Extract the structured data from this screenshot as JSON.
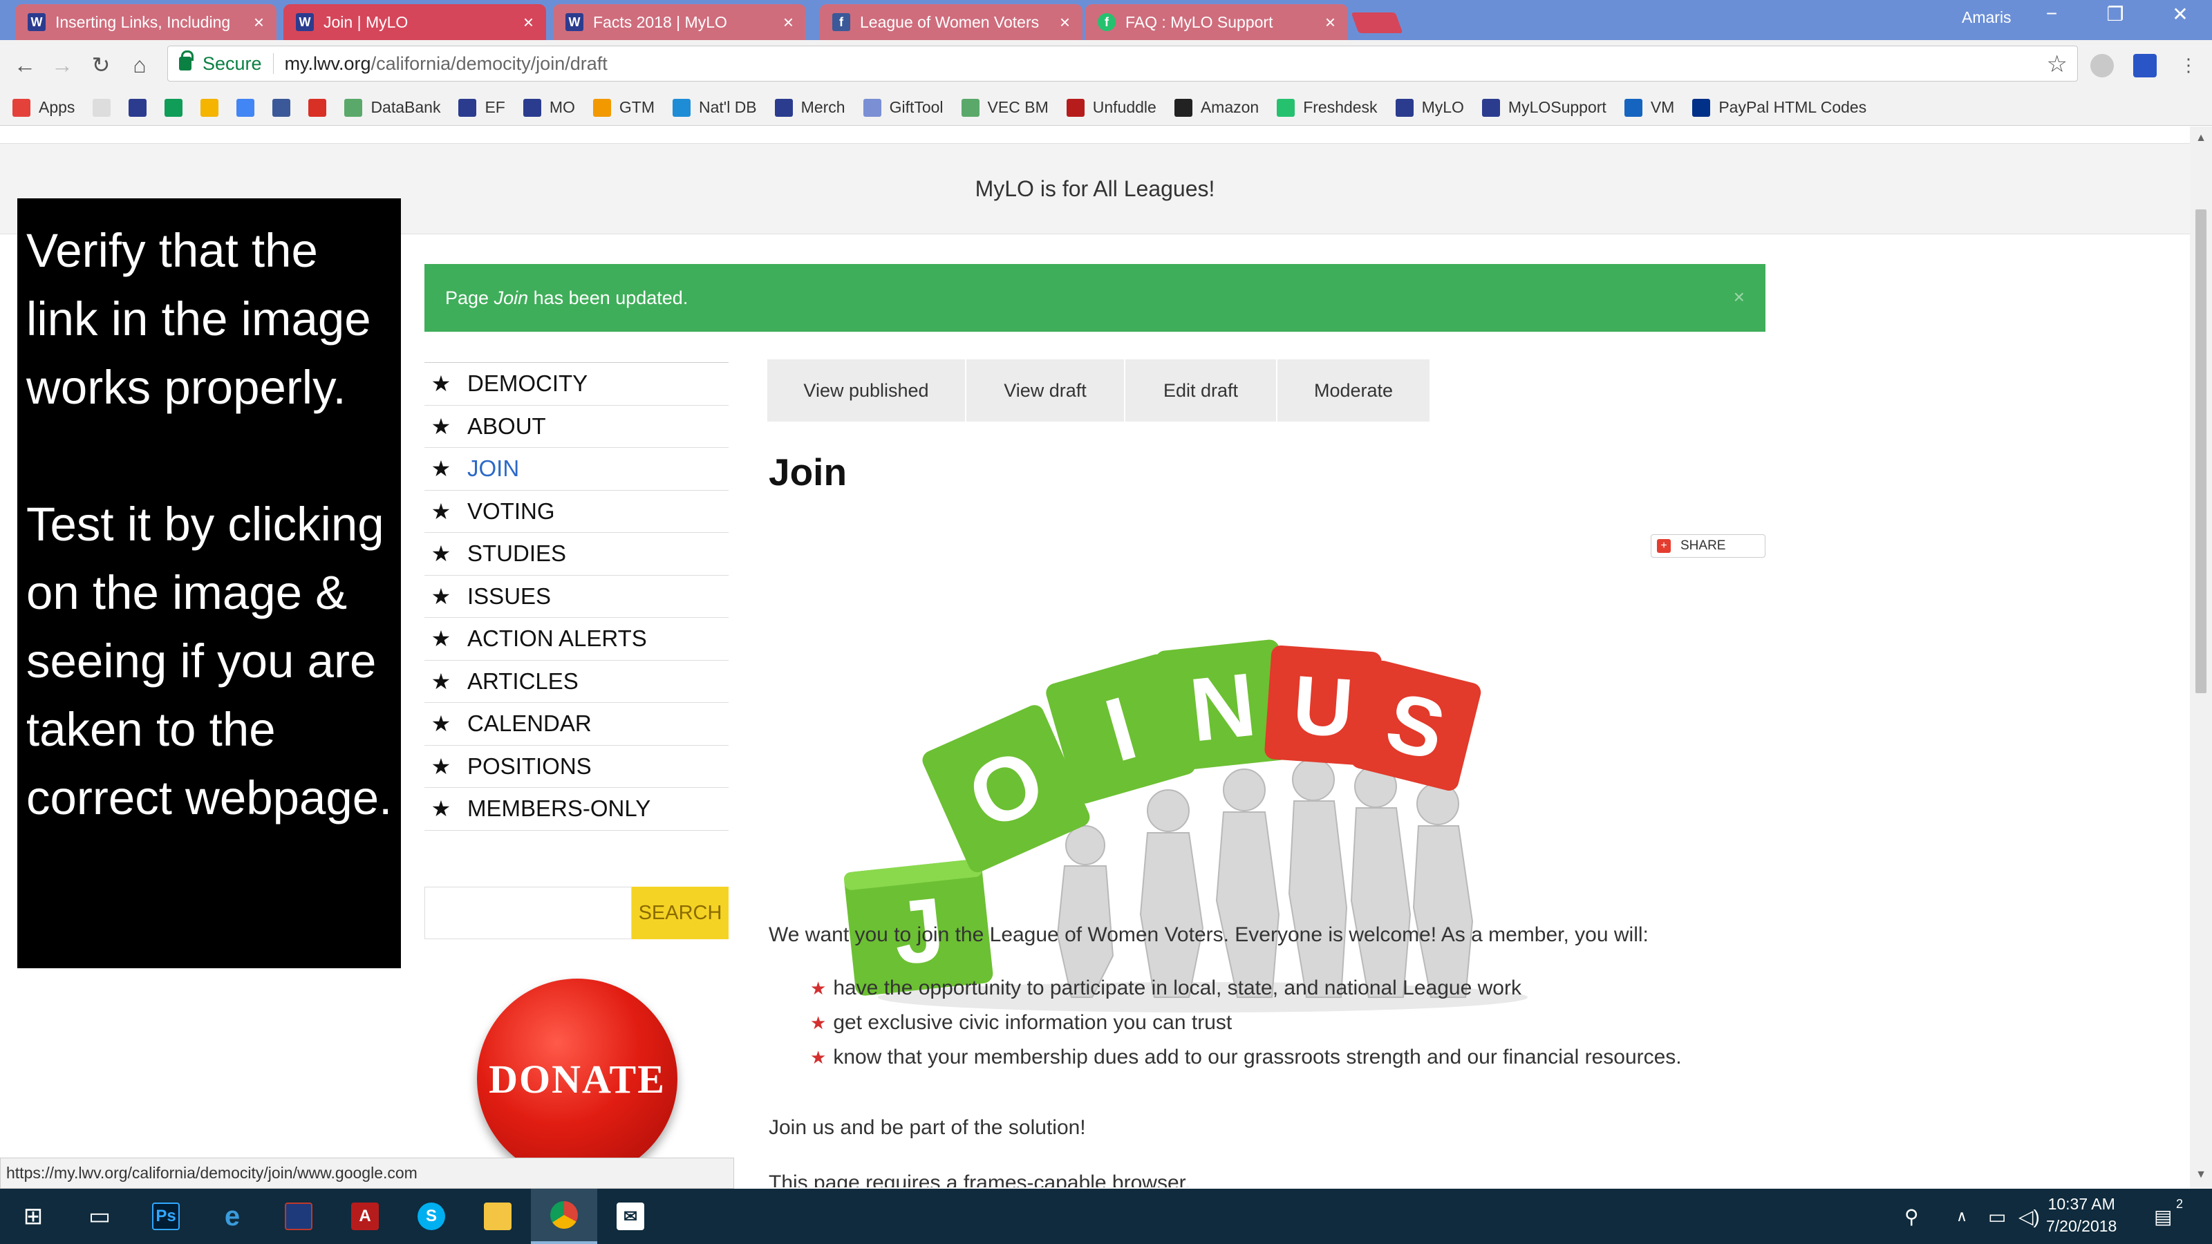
{
  "browser": {
    "tabs": [
      {
        "title": "Inserting Links, Including",
        "icon": "lwv-icon"
      },
      {
        "title": "Join | MyLO",
        "icon": "lwv-icon"
      },
      {
        "title": "Facts 2018 | MyLO",
        "icon": "lwv-icon"
      },
      {
        "title": "League of Women Voters",
        "icon": "facebook-icon"
      },
      {
        "title": "FAQ : MyLO Support",
        "icon": "freshdesk-icon"
      }
    ],
    "active_tab_index": 1,
    "profile_name": "Amaris",
    "secure_label": "Secure",
    "url_host": "my.lwv.org",
    "url_path": "/california/democity/join/draft",
    "bookmarks": [
      {
        "label": "Apps",
        "icon": "apps-grid-icon",
        "color": "#e4413b"
      },
      {
        "label": "",
        "icon": "page-icon",
        "color": "#dddddd"
      },
      {
        "label": "",
        "icon": "lwv-icon",
        "color": "#2b3c8f"
      },
      {
        "label": "",
        "icon": "sheets-icon",
        "color": "#0f9d58"
      },
      {
        "label": "",
        "icon": "drive-icon",
        "color": "#f4b400"
      },
      {
        "label": "",
        "icon": "docs-icon",
        "color": "#4285f4"
      },
      {
        "label": "",
        "icon": "facebook-icon",
        "color": "#3b5998"
      },
      {
        "label": "",
        "icon": "red-bookmark-icon",
        "color": "#d93025"
      },
      {
        "label": "DataBank",
        "icon": "check-icon",
        "color": "#5aa96a"
      },
      {
        "label": "EF",
        "icon": "lwv-icon",
        "color": "#2b3c8f"
      },
      {
        "label": "MO",
        "icon": "lwv-icon",
        "color": "#2b3c8f"
      },
      {
        "label": "GTM",
        "icon": "gtm-icon",
        "color": "#f29900"
      },
      {
        "label": "Nat'l DB",
        "icon": "cloud-icon",
        "color": "#1f8dd6"
      },
      {
        "label": "Merch",
        "icon": "lwv-icon",
        "color": "#2b3c8f"
      },
      {
        "label": "GiftTool",
        "icon": "gift-icon",
        "color": "#7a8fd4"
      },
      {
        "label": "VEC BM",
        "icon": "check-icon",
        "color": "#5aa96a"
      },
      {
        "label": "Unfuddle",
        "icon": "unfuddle-icon",
        "color": "#b71c1c"
      },
      {
        "label": "Amazon",
        "icon": "amazon-icon",
        "color": "#222222"
      },
      {
        "label": "Freshdesk",
        "icon": "freshdesk-icon",
        "color": "#25c16f"
      },
      {
        "label": "MyLO",
        "icon": "lwv-icon",
        "color": "#2b3c8f"
      },
      {
        "label": "MyLOSupport",
        "icon": "support-icon",
        "color": "#2b3c8f"
      },
      {
        "label": "VM",
        "icon": "cb-icon",
        "color": "#1565c0"
      },
      {
        "label": "PayPal HTML Codes",
        "icon": "paypal-icon",
        "color": "#003087"
      }
    ],
    "status_url": "https://my.lwv.org/california/democity/join/www.google.com"
  },
  "page": {
    "banner": "MyLO is for All Leagues!",
    "alert": {
      "prefix": "Page ",
      "page_name": "Join",
      "suffix": " has been updated.",
      "close": "×"
    },
    "nav": [
      "DEMOCITY",
      "ABOUT",
      "JOIN",
      "VOTING",
      "STUDIES",
      "ISSUES",
      "ACTION ALERTS",
      "ARTICLES",
      "CALENDAR",
      "POSITIONS",
      "MEMBERS-ONLY"
    ],
    "nav_active_index": 2,
    "search_button": "SEARCH",
    "donate_label": "DONATE",
    "tabs": [
      "View published",
      "View draft",
      "Edit draft",
      "Moderate"
    ],
    "title": "Join",
    "share_label": "SHARE",
    "hero_letters": [
      "J",
      "O",
      "I",
      "N",
      "U",
      "S"
    ],
    "intro": "We want you to join the League of Women Voters. Everyone is welcome! As a member, you will:",
    "bullets": [
      "have the opportunity to participate in local, state, and national League work",
      "get exclusive civic information you can trust",
      "know that your membership dues add to our grassroots strength and our financial resources."
    ],
    "outro": "Join us and be part of the solution!",
    "cutoff": "This page requires a frames-capable browser."
  },
  "overlay": {
    "paragraph1": "Verify that the link in the image works properly.",
    "paragraph2": "Test it by clicking on the image & seeing if you are taken to the correct webpage."
  },
  "taskbar": {
    "apps": [
      "windows-start-icon",
      "task-view-icon",
      "photoshop-icon",
      "edge-icon",
      "app-icon",
      "acrobat-icon",
      "skype-icon",
      "file-explorer-icon",
      "chrome-icon",
      "mail-icon"
    ],
    "active_app": "chrome-icon",
    "time": "10:37 AM",
    "date": "7/20/2018",
    "notifications": "2"
  },
  "colors": {
    "tab_active": "#d5465a",
    "tab_strip": "#6b8fd6",
    "alert_green": "#3fae5a",
    "search_yellow": "#f5d324",
    "nav_active": "#2c69c8",
    "donate_red": "#e11d12",
    "hero_green": "#6cc033",
    "hero_red": "#e23a2b"
  }
}
